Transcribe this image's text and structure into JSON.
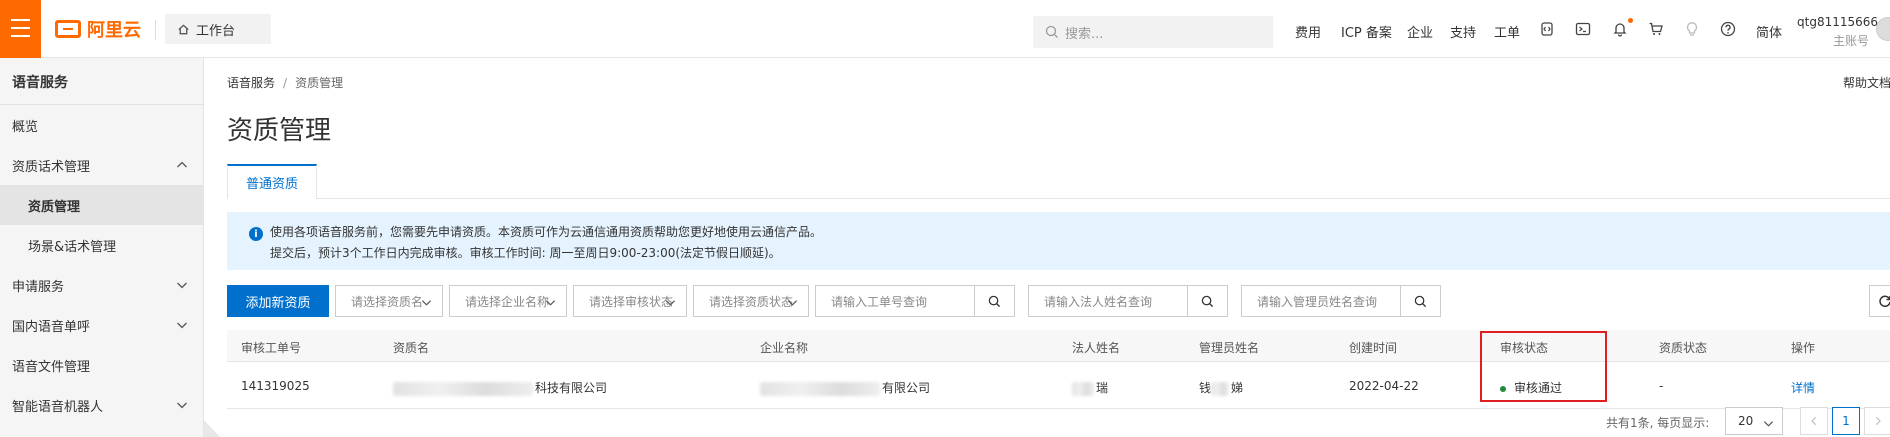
{
  "header": {
    "logo_text": "阿里云",
    "workbench": "工作台",
    "search_placeholder": "搜索...",
    "nav": [
      "费用",
      "ICP 备案",
      "企业",
      "支持",
      "工单"
    ],
    "lang": "简体",
    "username": "qtg81115666",
    "role": "主账号"
  },
  "sidebar": {
    "title": "语音服务",
    "items": [
      {
        "label": "概览"
      },
      {
        "label": "资质话术管理"
      },
      {
        "label": "资质管理"
      },
      {
        "label": "场景&话术管理"
      },
      {
        "label": "申请服务"
      },
      {
        "label": "国内语音单呼"
      },
      {
        "label": "语音文件管理"
      },
      {
        "label": "智能语音机器人"
      }
    ]
  },
  "main": {
    "breadcrumb": [
      "语音服务",
      "资质管理"
    ],
    "breadcrumb_sep": "/",
    "help_doc": "帮助文档",
    "title": "资质管理",
    "tab": "普通资质",
    "notice_line1": "使用各项语音服务前，您需要先申请资质。本资质可作为云通信通用资质帮助您更好地使用云通信产品。",
    "notice_line2": "提交后，预计3个工作日内完成审核。审核工作时间: 周一至周日9:00-23:00(法定节假日顺延)。"
  },
  "filters": {
    "add_button": "添加新资质",
    "select_qual_name": "请选择资质名",
    "select_company": "请选择企业名称",
    "select_review_status": "请选择审核状态",
    "select_qual_status": "请选择资质状态",
    "input_ticket": "请输入工单号查询",
    "input_legal_name": "请输入法人姓名查询",
    "input_admin_name": "请输入管理员姓名查询"
  },
  "table": {
    "columns": [
      "审核工单号",
      "资质名",
      "企业名称",
      "法人姓名",
      "管理员姓名",
      "创建时间",
      "审核状态",
      "资质状态",
      "操作"
    ],
    "rows": [
      {
        "ticket": "141319025",
        "qual_name_suffix": "科技有限公司",
        "company_suffix": "有限公司",
        "legal_suffix": "瑞",
        "admin_prefix": "钱",
        "admin_suffix": "娣",
        "created": "2022-04-22",
        "review_status": "审核通过",
        "qual_status": "-",
        "action": "详情"
      }
    ]
  },
  "pager": {
    "total": "共有1条, 每页显示:",
    "page_size": "20",
    "current_page": "1"
  },
  "colors": {
    "brand": "#ff6a00",
    "primary": "#0070cc",
    "success": "#1e8e3e",
    "highlight": "#e02020",
    "notice_bg": "#e5f3ff"
  }
}
